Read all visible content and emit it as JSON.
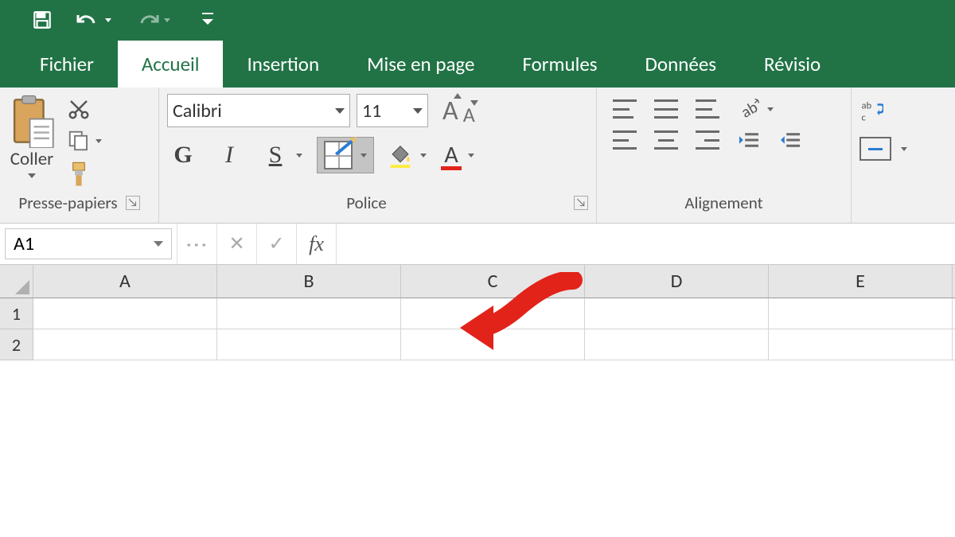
{
  "tabs": [
    "Fichier",
    "Accueil",
    "Insertion",
    "Mise en page",
    "Formules",
    "Données",
    "Révisio"
  ],
  "active_tab": "Accueil",
  "clipboard": {
    "paste_label": "Coller",
    "group_label": "Presse-papiers"
  },
  "font": {
    "name": "Calibri",
    "size": "11",
    "group_label": "Police",
    "bold": "G",
    "italic": "I",
    "underline": "S",
    "grow": "A",
    "shrink": "A",
    "font_color_letter": "A"
  },
  "alignment": {
    "group_label": "Alignement",
    "wrap_label": "ab\nc"
  },
  "name_box": "A1",
  "fx_label": "fx",
  "columns": [
    "A",
    "B",
    "C",
    "D",
    "E"
  ],
  "rows": [
    "1",
    "2"
  ]
}
